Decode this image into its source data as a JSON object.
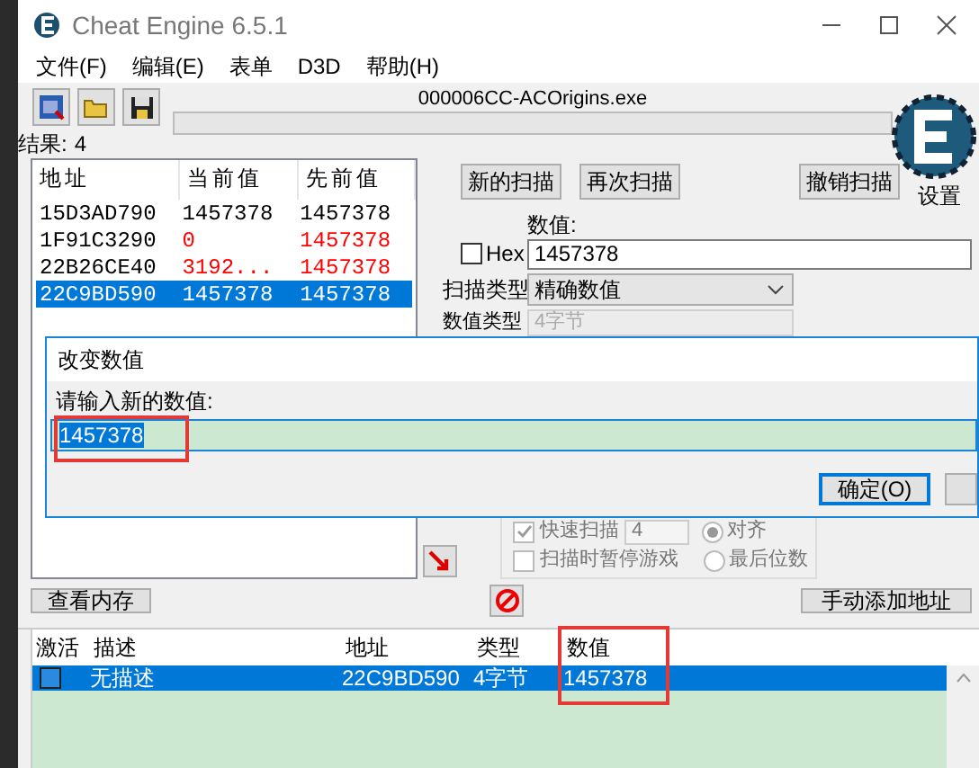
{
  "window": {
    "title": "Cheat Engine 6.5.1"
  },
  "menu": [
    "文件(F)",
    "编辑(E)",
    "表单",
    "D3D",
    "帮助(H)"
  ],
  "process_name": "000006CC-ACOrigins.exe",
  "progress": {
    "level": 0
  },
  "results_label": "结果:",
  "results_count": "4",
  "results": {
    "columns": [
      "地址",
      "当前值",
      "先前值"
    ],
    "rows": [
      {
        "address": "15D3AD790",
        "current": {
          "text": "1457378",
          "changed": false
        },
        "previous": {
          "text": "1457378",
          "changed": false
        },
        "selected": false
      },
      {
        "address": "1F91C3290",
        "current": {
          "text": "0",
          "changed": true
        },
        "previous": {
          "text": "1457378",
          "changed": true
        },
        "selected": false
      },
      {
        "address": "22B26CE40",
        "current": {
          "text": "3192...",
          "changed": true
        },
        "previous": {
          "text": "1457378",
          "changed": true
        },
        "selected": false
      },
      {
        "address": "22C9BD590",
        "current": {
          "text": "1457378",
          "changed": false
        },
        "previous": {
          "text": "1457378",
          "changed": false
        },
        "selected": true
      }
    ]
  },
  "scan_buttons": [
    "新的扫描",
    "再次扫描",
    "撤销扫描"
  ],
  "settings_label": "设置",
  "value_label": "数值:",
  "hex": {
    "label": "Hex",
    "checked": false
  },
  "value_input": "1457378",
  "scan_type": {
    "label": "扫描类型",
    "value": "精确数值"
  },
  "value_type": {
    "label": "数值类型",
    "value": "4字节",
    "disabled": true
  },
  "quick_scan": {
    "label": "快速扫描",
    "checked": true,
    "value": "4"
  },
  "alignment": [
    {
      "label": "对齐",
      "selected": true
    },
    {
      "label": "最后位数",
      "selected": false
    }
  ],
  "pause_game": {
    "label": "扫描时暂停游戏",
    "checked": false
  },
  "view_memory": "查看内存",
  "add_address": "手动添加地址",
  "address_list": {
    "columns": [
      "激活",
      "描述",
      "地址",
      "类型",
      "数值"
    ],
    "rows": [
      {
        "active": false,
        "description": "无描述",
        "address": "22C9BD590",
        "type": "4字节",
        "value": "1457378",
        "selected": true
      }
    ]
  },
  "dialog": {
    "title": "改变数值",
    "prompt": "请输入新的数值:",
    "value": "1457378",
    "ok": "确定(O)"
  }
}
